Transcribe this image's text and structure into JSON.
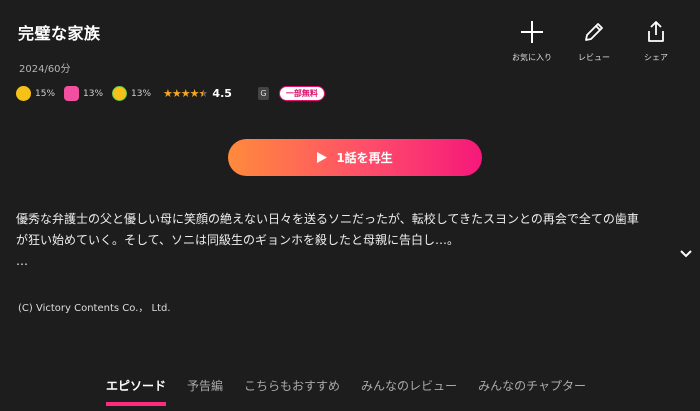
{
  "header": {
    "title": "完璧な家族",
    "meta": "2024/60分"
  },
  "actions": [
    {
      "label": "お気に入り",
      "icon": "plus-icon"
    },
    {
      "label": "レビュー",
      "icon": "pencil-icon"
    },
    {
      "label": "シェア",
      "icon": "share-icon"
    }
  ],
  "stats": {
    "emotions": [
      {
        "icon": "smirk-emoji-icon",
        "percent": "15%"
      },
      {
        "icon": "pink-face-emoji-icon",
        "percent": "13%"
      },
      {
        "icon": "green-face-emoji-icon",
        "percent": "13%"
      }
    ],
    "stars_filled": 4.5,
    "score": "4.5",
    "rating_badge": "G",
    "free_badge": "一部無料"
  },
  "play": {
    "label": "1話を再生"
  },
  "description": {
    "line1": "優秀な弁護士の父と優しい母に笑顔の絶えない日々を送るソニだったが、転校してきたスヨンとの再会で全ての歯車",
    "line2": "が狂い始めていく。そして、ソニは同級生のギョンホを殺したと母親に告白し…。",
    "line3": "…"
  },
  "copyright": "(C) Victory Contents Co.， Ltd.",
  "tabs": [
    {
      "label": "エピソード",
      "active": true
    },
    {
      "label": "予告編",
      "active": false
    },
    {
      "label": "こちらもおすすめ",
      "active": false
    },
    {
      "label": "みんなのレビュー",
      "active": false
    },
    {
      "label": "みんなのチャプター",
      "active": false
    }
  ],
  "colors": {
    "background": "#1d1d1d",
    "accent": "#ff2c7d",
    "star": "#f5a623"
  }
}
